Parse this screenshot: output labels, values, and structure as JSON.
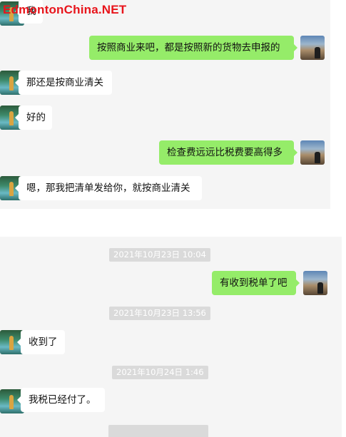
{
  "watermark": "EdmontonChina.NET",
  "messages_top": [
    {
      "side": "in",
      "text": "我"
    },
    {
      "side": "out",
      "text": "按照商业来吧，都是按照新的货物去申报的"
    },
    {
      "side": "in",
      "text": "那还是按商业清关"
    },
    {
      "side": "in",
      "text": "好的"
    },
    {
      "side": "out",
      "text": "检查费远远比税费要高得多"
    },
    {
      "side": "in",
      "text": "嗯，那我把清单发给你，就按商业清关"
    }
  ],
  "conversation_bottom": [
    {
      "kind": "timestamp",
      "text": "2021年10月23日 10:04"
    },
    {
      "kind": "message",
      "side": "out",
      "text": "有收到税单了吧"
    },
    {
      "kind": "timestamp",
      "text": "2021年10月23日 13:56"
    },
    {
      "kind": "message",
      "side": "in",
      "text": "收到了"
    },
    {
      "kind": "timestamp",
      "text": "2021年10月24日 1:46"
    },
    {
      "kind": "message",
      "side": "in",
      "text": "我税已经付了。"
    }
  ]
}
